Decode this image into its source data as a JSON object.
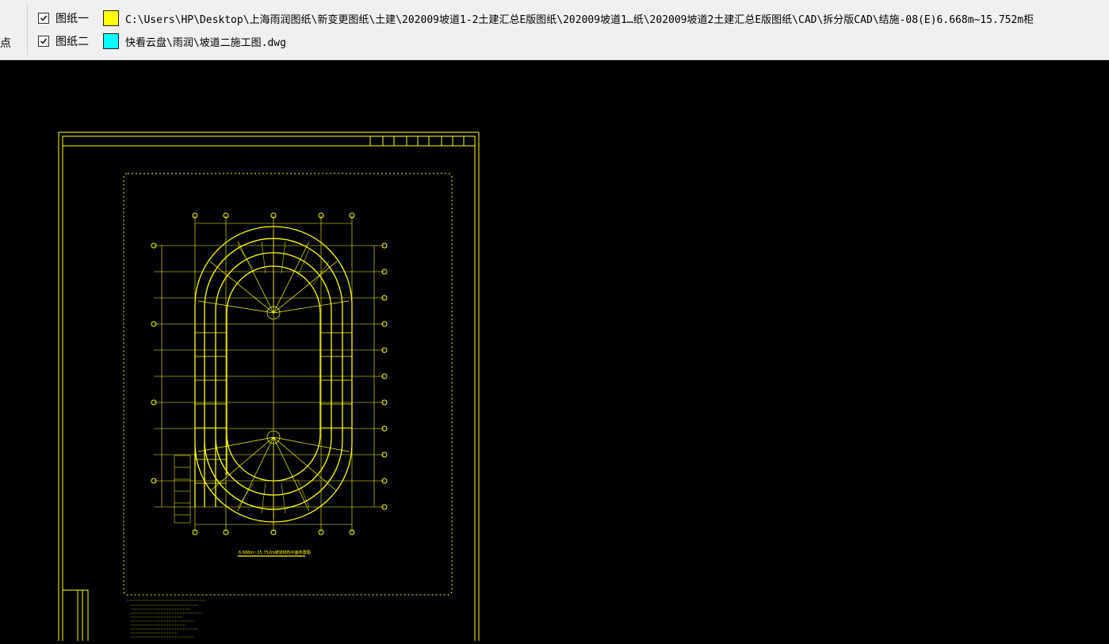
{
  "toolbar": {
    "partial_label": "点",
    "drawings": [
      {
        "checked": true,
        "label": "图纸一",
        "color": "#ffff00",
        "path": "C:\\Users\\HP\\Desktop\\上海雨润图纸\\新变更图纸\\土建\\202009坡道1-2土建汇总E版图纸\\202009坡道1…纸\\202009坡道2土建汇总E版图纸\\CAD\\拆分版CAD\\结施-08(E)6.668m~15.752m柜"
      },
      {
        "checked": true,
        "label": "图纸二",
        "color": "#00ffff",
        "path": "快看云盘\\雨润\\坡道二施工图.dwg"
      }
    ]
  },
  "canvas": {
    "background": "#000000",
    "line_color": "#ffff00",
    "plan_title": "6.668m~15.752m坡道结构平面布置图"
  }
}
